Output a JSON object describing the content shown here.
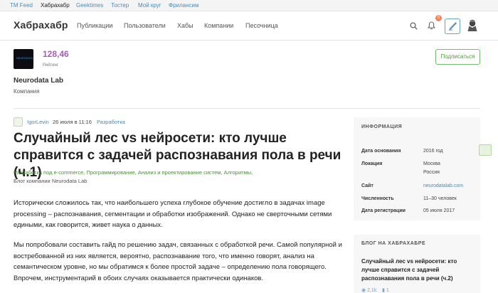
{
  "topbar": {
    "links": [
      "TM Feed",
      "Хабрахабр",
      "Geektimes",
      "Тостер",
      "Мой круг",
      "Фрилансим"
    ]
  },
  "header": {
    "logo": "Хабрахабр",
    "nav": [
      "Публикации",
      "Пользователи",
      "Хабы",
      "Компании",
      "Песочница"
    ],
    "notification_count": "6",
    "icons": [
      "search-icon",
      "bell-icon",
      "pen-icon",
      "avatar"
    ]
  },
  "company": {
    "logo_text": "NEURODATA",
    "rating": "128,46",
    "rating_label": "Рейтинг",
    "name": "Neurodata Lab",
    "type": "Компания",
    "subscribe_label": "Подписаться"
  },
  "post": {
    "author": "IgorLevin",
    "date": "26 июля в 11:16",
    "category": "Разработка",
    "title": "Случайный лес vs нейросети: кто лучше справится с задачей распознавания пола в речи (ч.1)",
    "hubs": [
      "Разработка под e-commerce,",
      "Программирование,",
      "Анализ и проектирование систем,",
      "Алгоритмы,"
    ],
    "blog": "Блог компании Neurodata Lab",
    "paragraphs": [
      "Исторически сложилось так, что наибольшего успеха глубокое обучение достигло в задачах image processing – распознавания, сегментации и обработки изображений. Однако не сверточными сетями едиными, как говорится, живет наука о данных.",
      "Мы попробовали составить гайд по решению задач, связанных с обработкой речи. Самой популярной и востребованной из них является, вероятно, распознавание того, что именно говорят, анализ на семантическом уровне, но мы обратимся к более простой задаче – определению пола говорящего. Впрочем, инструментарий в обоих случаях оказывается практически одинаков."
    ]
  },
  "sidebar": {
    "info_title": "ИНФОРМАЦИЯ",
    "info": [
      {
        "key": "Дата основания",
        "value": "2016 год"
      },
      {
        "key": "Локация",
        "value": "Москва"
      },
      {
        "key": "",
        "value": "Россия"
      },
      {
        "key": "Сайт",
        "value": "neurodatalab.com"
      },
      {
        "key": "Численность",
        "value": "11–30 человек"
      },
      {
        "key": "Дата регистрации",
        "value": "05 июля 2017"
      }
    ],
    "blog_title": "БЛОГ НА ХАБРАХАБРЕ",
    "blog_post_title": "Случайный лес vs нейросети: кто лучше справится с задачей распознавания пола в речи (ч.2)",
    "blog_post_views": "2,1k",
    "blog_post_comments": "1"
  },
  "colors": {
    "link": "#4a8bb8",
    "rating": "#a65cb6",
    "hub": "#4e8c3c",
    "subscribe": "#6fbf6a"
  }
}
